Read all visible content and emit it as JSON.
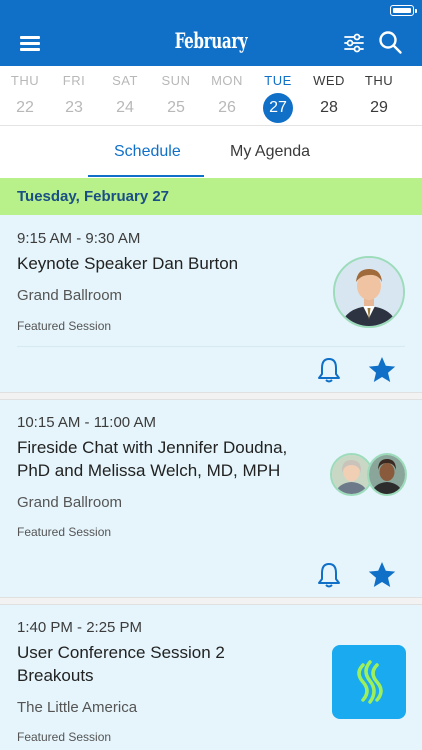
{
  "app_bar": {
    "title": "February"
  },
  "date_strip": {
    "days": [
      {
        "name": "THU",
        "num": "22"
      },
      {
        "name": "FRI",
        "num": "23"
      },
      {
        "name": "SAT",
        "num": "24"
      },
      {
        "name": "SUN",
        "num": "25"
      },
      {
        "name": "MON",
        "num": "26"
      },
      {
        "name": "TUE",
        "num": "27"
      },
      {
        "name": "WED",
        "num": "28"
      },
      {
        "name": "THU",
        "num": "29"
      }
    ],
    "selected": "27"
  },
  "tabs": {
    "schedule": "Schedule",
    "agenda": "My Agenda",
    "active": "Schedule"
  },
  "day_header": "Tuesday, February 27",
  "sessions": [
    {
      "time": "9:15 AM - 9:30 AM",
      "title": "Keynote Speaker Dan Burton",
      "room": "Grand Ballroom",
      "tag": "Featured Session"
    },
    {
      "time": "10:15 AM - 11:00 AM",
      "title": "Fireside Chat with Jennifer Doudna, PhD and Melissa Welch, MD, MPH",
      "room": "Grand Ballroom",
      "tag": "Featured Session"
    },
    {
      "time": "1:40 PM - 2:25 PM",
      "title": "User Conference Session 2 Breakouts",
      "room": "The Little America",
      "tag": "Featured Session"
    }
  ],
  "colors": {
    "brand_blue": "#1070c8",
    "day_header_green": "#b8f08a",
    "card_bg": "#e5f5fb",
    "logo_tile": "#1aaaf0",
    "logo_flame": "#9ef05a"
  },
  "icons": [
    "menu-icon",
    "filter-sliders-icon",
    "search-icon",
    "bell-icon",
    "star-icon",
    "battery-icon"
  ]
}
